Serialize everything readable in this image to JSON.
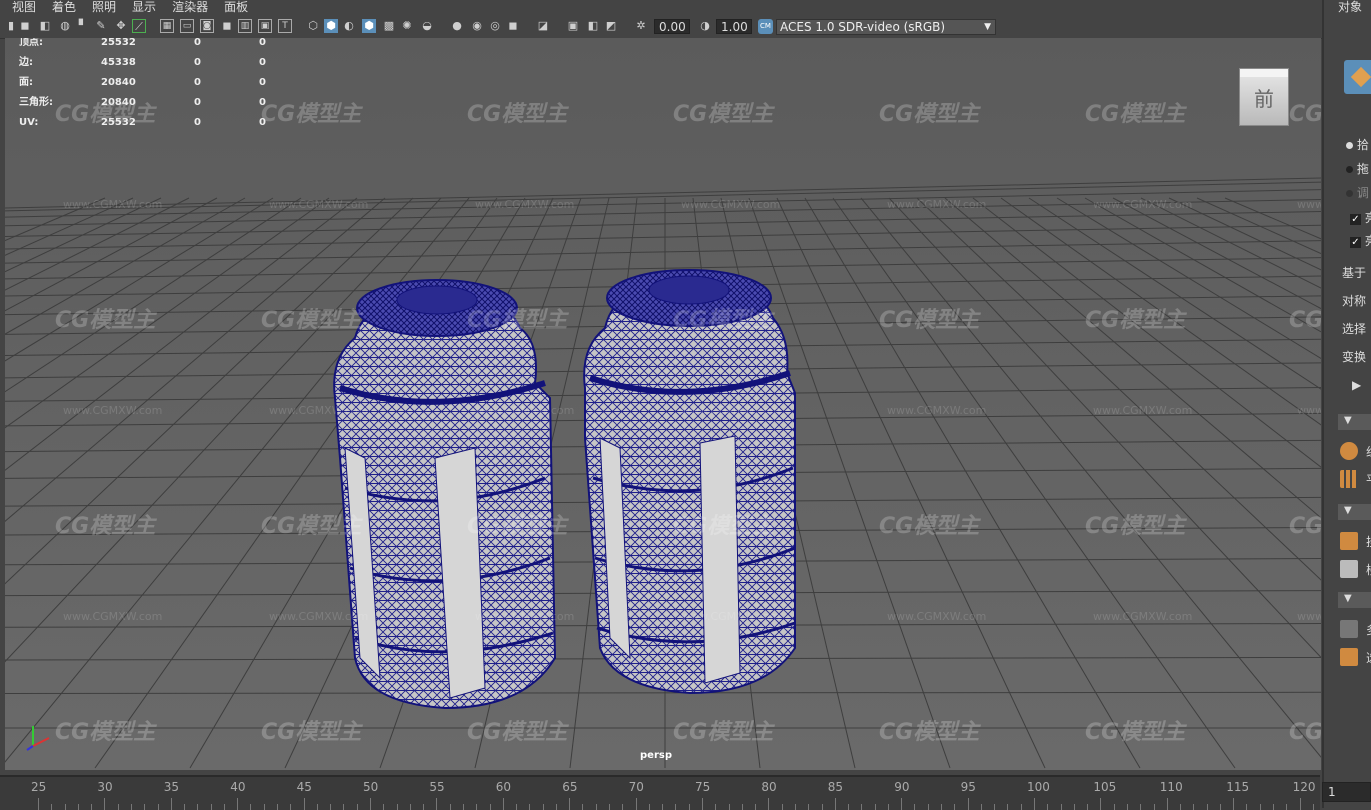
{
  "menu": [
    "视图",
    "着色",
    "照明",
    "显示",
    "渲染器",
    "面板"
  ],
  "toolbar": {
    "exposure": "0.00",
    "gamma": "1.00",
    "color_space": "ACES 1.0 SDR-video (sRGB)",
    "cm_badge": "CM"
  },
  "hud": {
    "rows": [
      {
        "label": "顶点:",
        "v1": "25532",
        "v2": "0",
        "v3": "0"
      },
      {
        "label": "边:",
        "v1": "45338",
        "v2": "0",
        "v3": "0"
      },
      {
        "label": "面:",
        "v1": "20840",
        "v2": "0",
        "v3": "0"
      },
      {
        "label": "三角形:",
        "v1": "20840",
        "v2": "0",
        "v3": "0"
      },
      {
        "label": "UV:",
        "v1": "25532",
        "v2": "0",
        "v3": "0"
      }
    ]
  },
  "viewcube_label": "前",
  "camera_label": "persp",
  "right_panel": {
    "title": "对象",
    "label_base": "基于",
    "label_sym": "对称",
    "label_select": "选择",
    "label_transform": "变换",
    "radio_labels": [
      "拾",
      "拖",
      "调"
    ],
    "check_labels": [
      "亮",
      "亮"
    ],
    "tool_labels": [
      "组",
      "平",
      "挂",
      "楼",
      "多",
      "选"
    ]
  },
  "timeline": {
    "ticks": [
      "25",
      "30",
      "35",
      "40",
      "45",
      "50",
      "55",
      "60",
      "65",
      "70",
      "75",
      "80",
      "85",
      "90",
      "95",
      "100",
      "105",
      "110",
      "115",
      "120"
    ],
    "current_frame": "1"
  },
  "watermark": {
    "brand": "CG模型主",
    "url": "www.CGMXW.com"
  },
  "colors": {
    "wire": "#1a1a8c",
    "surface": "#c9c9c9",
    "accent": "#5b8fb9"
  }
}
